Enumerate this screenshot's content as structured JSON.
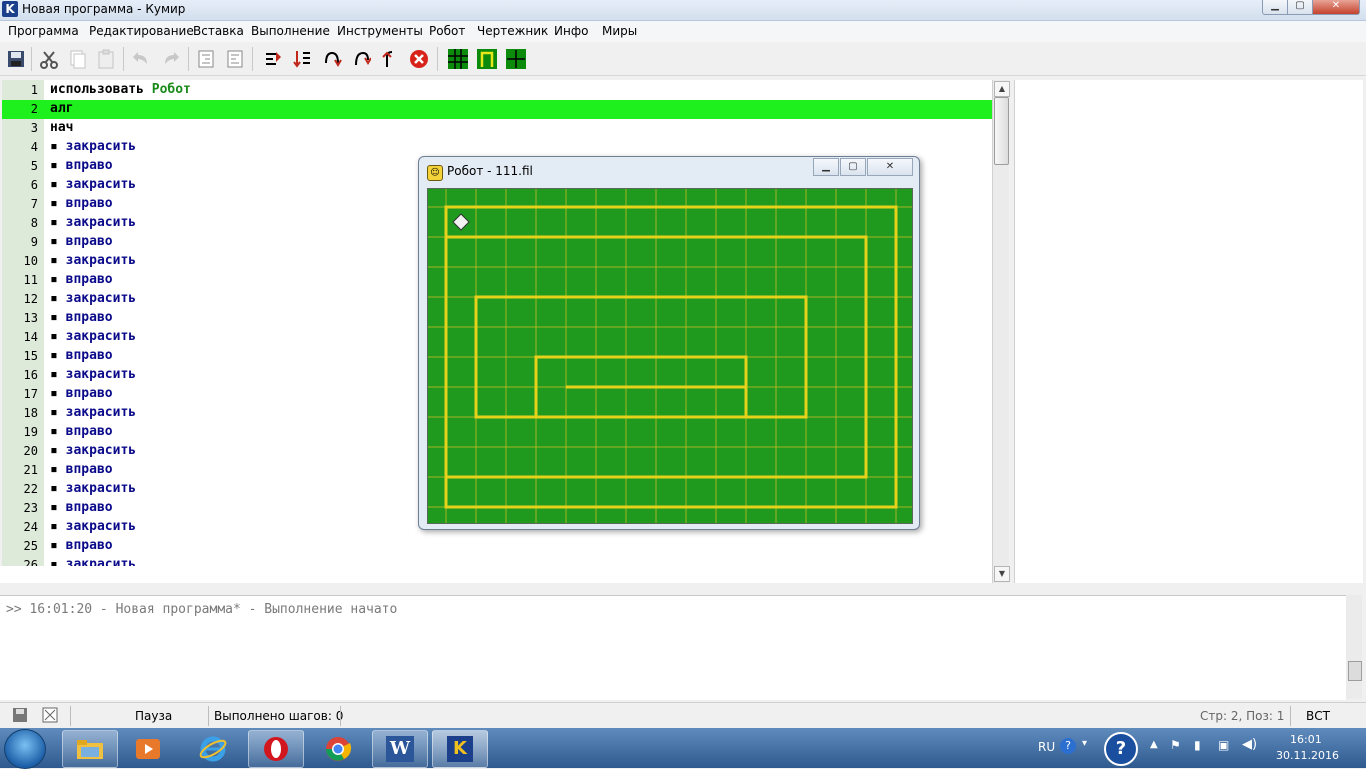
{
  "window": {
    "title": "Новая программа - Кумир",
    "app_icon": "K",
    "min": "▁",
    "max": "▢",
    "close": "✕"
  },
  "menu": [
    "Программа",
    "Редактирование",
    "Вставка",
    "Выполнение",
    "Инструменты",
    "Робот",
    "Чертежник",
    "Инфо",
    "Миры"
  ],
  "toolbar_icons": [
    "save-icon",
    "cut-icon",
    "copy-icon",
    "paste-icon",
    "undo-icon",
    "redo-icon",
    "indent-icon",
    "unindent-icon",
    "run-icon",
    "run-steps-icon",
    "step-into-icon",
    "step-over-icon",
    "step-out-icon",
    "stop-icon",
    "robot-field-icon",
    "drawer-icon",
    "grid-icon"
  ],
  "editor": {
    "current_line": 2,
    "lines": [
      {
        "num": "1",
        "kw": "использовать",
        "arg": "Робот"
      },
      {
        "num": "2",
        "kw": "алг"
      },
      {
        "num": "3",
        "kw": "нач"
      },
      {
        "num": "4",
        "cmd": "закрасить"
      },
      {
        "num": "5",
        "cmd": "вправо"
      },
      {
        "num": "6",
        "cmd": "закрасить"
      },
      {
        "num": "7",
        "cmd": "вправо"
      },
      {
        "num": "8",
        "cmd": "закрасить"
      },
      {
        "num": "9",
        "cmd": "вправо"
      },
      {
        "num": "10",
        "cmd": "закрасить"
      },
      {
        "num": "11",
        "cmd": "вправо"
      },
      {
        "num": "12",
        "cmd": "закрасить"
      },
      {
        "num": "13",
        "cmd": "вправо"
      },
      {
        "num": "14",
        "cmd": "закрасить"
      },
      {
        "num": "15",
        "cmd": "вправо"
      },
      {
        "num": "16",
        "cmd": "закрасить"
      },
      {
        "num": "17",
        "cmd": "вправо"
      },
      {
        "num": "18",
        "cmd": "закрасить"
      },
      {
        "num": "19",
        "cmd": "вправо"
      },
      {
        "num": "20",
        "cmd": "закрасить"
      },
      {
        "num": "21",
        "cmd": "вправо"
      },
      {
        "num": "22",
        "cmd": "закрасить"
      },
      {
        "num": "23",
        "cmd": "вправо"
      },
      {
        "num": "24",
        "cmd": "закрасить"
      },
      {
        "num": "25",
        "cmd": "вправо"
      },
      {
        "num": "26",
        "cmd": "закрасить"
      }
    ]
  },
  "robot_window": {
    "title": "Робот - 111.fil",
    "cols": 16,
    "rows": 11,
    "robot_cell": [
      0,
      0
    ]
  },
  "output": {
    "text": ">> 16:01:20 - Новая программа* - Выполнение начато"
  },
  "status": {
    "state": "Пауза",
    "steps": "Выполнено шагов: 0",
    "position": "Стр: 2, Поз: 1",
    "mode": "ВСТ"
  },
  "taskbar": {
    "apps": [
      "explorer",
      "media-player",
      "internet-explorer",
      "opera",
      "chrome",
      "word",
      "kumir"
    ],
    "word_label": "W",
    "kumir_label": "K"
  },
  "tray": {
    "lang": "RU",
    "time": "16:01",
    "date": "30.11.2016"
  },
  "colors": {
    "highlight": "#1ef01e",
    "field": "#1f9a1f",
    "wall": "#e6d21a",
    "keyword": "#000000",
    "command": "#0a0a8a",
    "module": "#1a8a1a"
  }
}
